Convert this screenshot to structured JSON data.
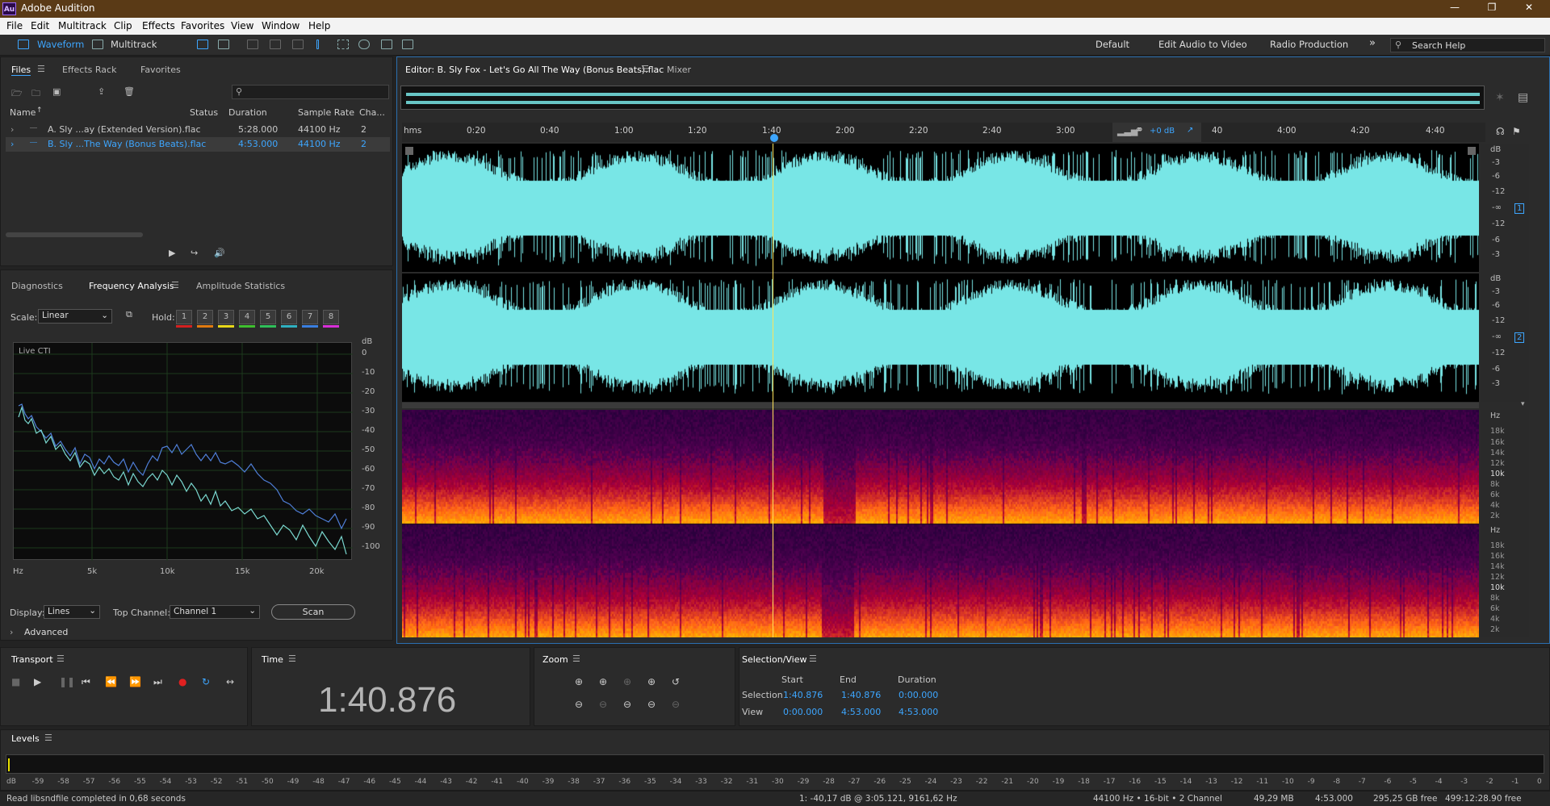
{
  "app": {
    "title": "Adobe Audition",
    "logo": "Au"
  },
  "menu": [
    "File",
    "Edit",
    "Multitrack",
    "Clip",
    "Effects",
    "Favorites",
    "View",
    "Window",
    "Help"
  ],
  "toolbar": {
    "waveform": "Waveform",
    "multitrack": "Multitrack",
    "workspaces": [
      "Default",
      "Edit Audio to Video",
      "Radio Production"
    ],
    "more": "»",
    "search_placeholder": "Search Help"
  },
  "files": {
    "tabs": [
      "Files",
      "Effects Rack",
      "Favorites"
    ],
    "search": "",
    "columns": [
      "Name",
      "Status",
      "Duration",
      "Sample Rate",
      "Cha..."
    ],
    "rows": [
      {
        "name": "A. Sly ...ay (Extended Version).flac",
        "status": "",
        "duration": "5:28.000",
        "rate": "44100 Hz",
        "ch": "2"
      },
      {
        "name": "B. Sly ...The Way (Bonus Beats).flac",
        "status": "",
        "duration": "4:53.000",
        "rate": "44100 Hz",
        "ch": "2"
      }
    ]
  },
  "analysis": {
    "tabs": [
      "Diagnostics",
      "Frequency Analysis",
      "Amplitude Statistics"
    ],
    "scale_label": "Scale:",
    "scale_value": "Linear",
    "hold_label": "Hold:",
    "holds": [
      "1",
      "2",
      "3",
      "4",
      "5",
      "6",
      "7",
      "8"
    ],
    "hold_colors": [
      "#d42020",
      "#e07a10",
      "#e8d81a",
      "#3fbf2f",
      "#2fbf5a",
      "#2fb0c0",
      "#3a7fe0",
      "#d82fd8"
    ],
    "live": "Live CTI",
    "db_unit": "dB",
    "y_ticks": [
      "0",
      "-10",
      "-20",
      "-30",
      "-40",
      "-50",
      "-60",
      "-70",
      "-80",
      "-90",
      "-100"
    ],
    "x_ticks": [
      "Hz",
      "5k",
      "10k",
      "15k",
      "20k"
    ],
    "display_label": "Display:",
    "display_value": "Lines",
    "top_channel_label": "Top Channel:",
    "top_channel_value": "Channel 1",
    "scan": "Scan",
    "advanced": "Advanced"
  },
  "editor": {
    "tab": "Editor: B. Sly Fox - Let's Go All The Way (Bonus Beats).flac",
    "mixer": "Mixer",
    "ruler": [
      "hms",
      "0:20",
      "0:40",
      "1:00",
      "1:20",
      "1:40",
      "2:00",
      "2:20",
      "2:40",
      "3:00",
      "4:00",
      "4:20",
      "4:40"
    ],
    "gain": "+0 dB",
    "partial": "40",
    "db_labels": [
      "dB",
      "-3",
      "-6",
      "-12",
      "-∞",
      "-12",
      "-6",
      "-3"
    ],
    "channels": [
      "1",
      "2"
    ],
    "hz_labels": [
      "Hz",
      "18k",
      "16k",
      "14k",
      "12k",
      "10k",
      "8k",
      "6k",
      "4k",
      "2k"
    ],
    "playhead_fraction": 0.344,
    "wave_color": "#78e6e6"
  },
  "transport": {
    "title": "Transport"
  },
  "time": {
    "title": "Time",
    "value": "1:40.876"
  },
  "zoom": {
    "title": "Zoom"
  },
  "selection": {
    "title": "Selection/View",
    "cols": [
      "Start",
      "End",
      "Duration"
    ],
    "rows": [
      {
        "label": "Selection",
        "start": "1:40.876",
        "end": "1:40.876",
        "dur": "0:00.000"
      },
      {
        "label": "View",
        "start": "0:00.000",
        "end": "4:53.000",
        "dur": "4:53.000"
      }
    ]
  },
  "levels": {
    "title": "Levels",
    "scale": [
      "dB",
      "-59",
      "-58",
      "-57",
      "-56",
      "-55",
      "-54",
      "-53",
      "-52",
      "-51",
      "-50",
      "-49",
      "-48",
      "-47",
      "-46",
      "-45",
      "-44",
      "-43",
      "-42",
      "-41",
      "-40",
      "-39",
      "-38",
      "-37",
      "-36",
      "-35",
      "-34",
      "-33",
      "-32",
      "-31",
      "-30",
      "-29",
      "-28",
      "-27",
      "-26",
      "-25",
      "-24",
      "-23",
      "-22",
      "-21",
      "-20",
      "-19",
      "-18",
      "-17",
      "-16",
      "-15",
      "-14",
      "-13",
      "-12",
      "-11",
      "-10",
      "-9",
      "-8",
      "-7",
      "-6",
      "-5",
      "-4",
      "-3",
      "-2",
      "-1",
      "0"
    ]
  },
  "status": {
    "left": "Read libsndfile completed in 0,68 seconds",
    "cursor": "1: -40,17 dB @ 3:05.121, 9161,62 Hz",
    "format": "44100 Hz • 16-bit • 2 Channel",
    "size": "49,29 MB",
    "dur": "4:53.000",
    "free": "295,25 GB free",
    "time_free": "499:12:28.90 free"
  }
}
